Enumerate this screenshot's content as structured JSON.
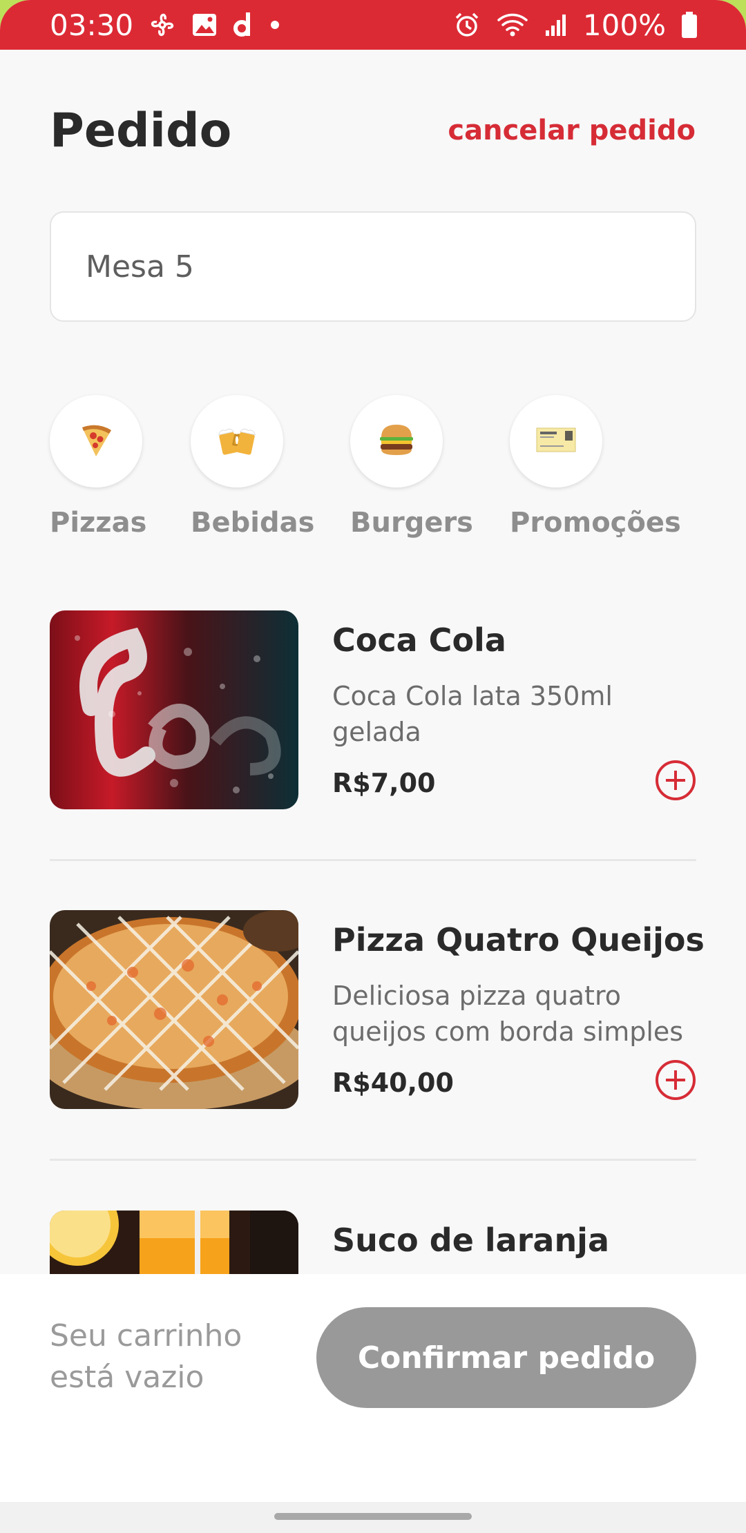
{
  "status_bar": {
    "time": "03:30",
    "battery": "100%",
    "icons_left": [
      "fan-icon",
      "gallery-icon",
      "app-d-icon",
      "notification-dot-icon"
    ],
    "icons_right": [
      "alarm-icon",
      "wifi-icon",
      "signal-icon",
      "battery-icon"
    ]
  },
  "header": {
    "title": "Pedido",
    "cancel_label": "cancelar pedido"
  },
  "table_field": {
    "value": "Mesa 5"
  },
  "categories": [
    {
      "label": "Pizzas",
      "icon": "pizza-icon"
    },
    {
      "label": "Bebidas",
      "icon": "beer-mugs-icon"
    },
    {
      "label": "Burgers",
      "icon": "burger-icon"
    },
    {
      "label": "Promoções",
      "icon": "ticket-icon"
    }
  ],
  "products": [
    {
      "name": "Coca Cola",
      "description": "Coca Cola lata 350ml gelada",
      "price": "R$7,00"
    },
    {
      "name": "Pizza Quatro Queijos",
      "description": "Deliciosa pizza quatro queijos com borda simples",
      "price": "R$40,00"
    },
    {
      "name": "Suco de laranja"
    }
  ],
  "cart": {
    "empty_text": "Seu carrinho está vazio",
    "confirm_label": "Confirmar pedido"
  },
  "colors": {
    "accent": "#dc2a35",
    "disabled_button": "#999999",
    "status_bar": "#dc2a35"
  }
}
